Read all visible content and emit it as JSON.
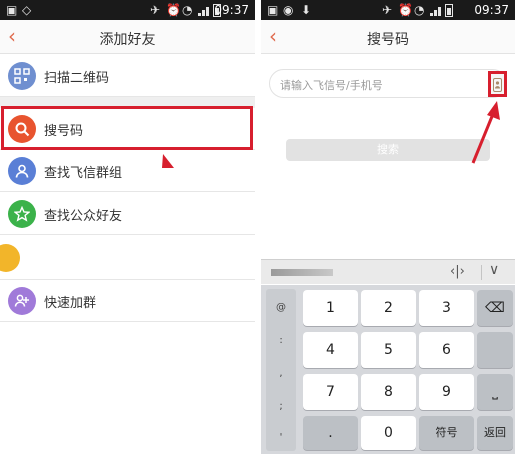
{
  "status_bar": {
    "time": "09:37",
    "network": "3G"
  },
  "left_screen": {
    "title": "添加好友",
    "back_icon": "chevron-left-icon",
    "items": [
      {
        "label": "扫描二维码",
        "icon": "qr-code-icon",
        "color": "#6f8fd0"
      },
      {
        "label": "搜号码",
        "icon": "search-icon",
        "color": "#e8542f"
      },
      {
        "label": "查找飞信群组",
        "icon": "group-icon",
        "color": "#5a7fd6"
      },
      {
        "label": "查找公众好友",
        "icon": "star-icon",
        "color": "#3bb24a"
      },
      {
        "label": "",
        "icon": "contact-icon",
        "color": "#f2b52a"
      },
      {
        "label": "快速加群",
        "icon": "quick-group-icon",
        "color": "#a07ad9"
      }
    ]
  },
  "right_screen": {
    "title": "搜号码",
    "search_placeholder": "请输入飞信号/手机号",
    "search_button": "搜索",
    "keyboard": {
      "symbols": [
        "@",
        ":",
        ",",
        ";",
        "'"
      ],
      "rows": [
        [
          "1",
          "2",
          "3"
        ],
        [
          "4",
          "5",
          "6"
        ],
        [
          "7",
          "8",
          "9"
        ],
        [
          ".",
          "0",
          "符号"
        ]
      ],
      "side_keys": [
        "delete-icon",
        "",
        "space-icon",
        "返回"
      ]
    }
  },
  "colors": {
    "accent": "#e06b4e",
    "highlight": "#d71f2e"
  }
}
